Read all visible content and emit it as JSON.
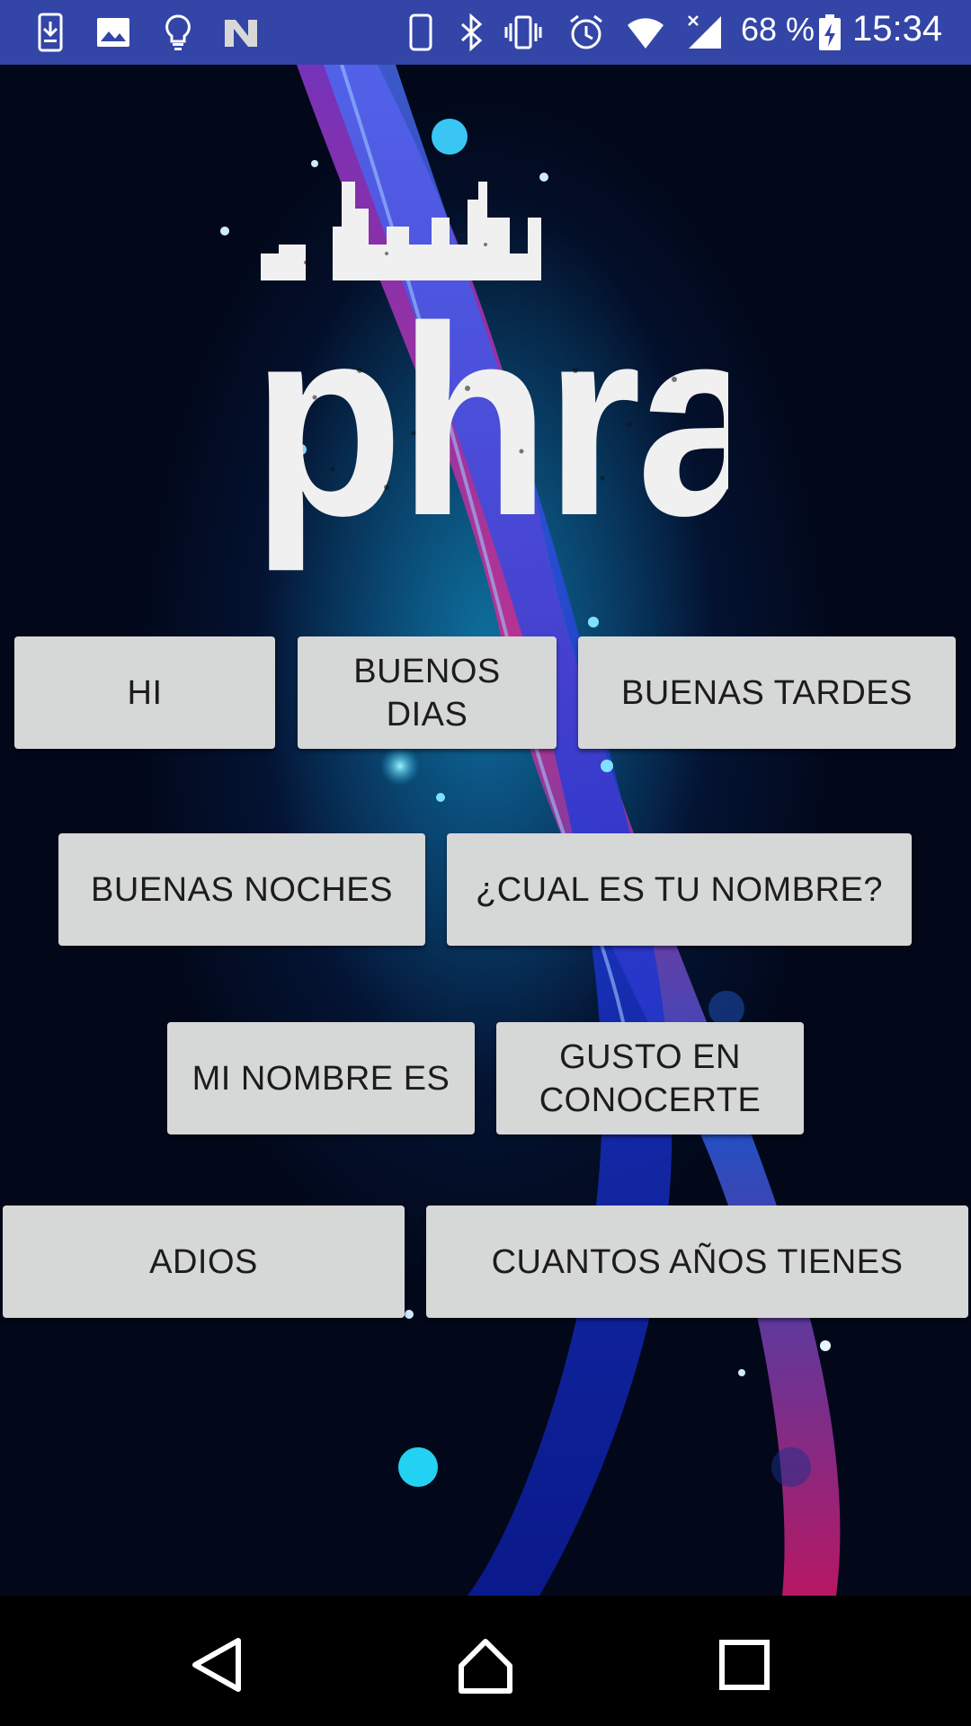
{
  "status_bar": {
    "left_icons": [
      "download-icon",
      "image-icon",
      "lightbulb-icon",
      "n-logo-icon"
    ],
    "right_icons": [
      "phone-icon",
      "bluetooth-icon",
      "vibrate-icon",
      "alarm-icon",
      "wifi-icon",
      "signal-icon"
    ],
    "battery_percent": "68 %",
    "time": "15:34"
  },
  "logo": {
    "text": "phrase"
  },
  "buttons": {
    "hi": "HI",
    "buenos_dias_line1": "BUENOS",
    "buenos_dias_line2": "DIAS",
    "buenas_tardes": "BUENAS TARDES",
    "buenas_noches": "BUENAS NOCHES",
    "cual_es_tu_nombre": "¿CUAL ES TU NOMBRE?",
    "mi_nombre_es": "MI NOMBRE ES",
    "gusto_line1": "GUSTO EN",
    "gusto_line2": "CONOCERTE",
    "adios": "ADIOS",
    "cuantos_anos": "CUANTOS AÑOS TIENES"
  },
  "nav_bar": {
    "icons": [
      "back-icon",
      "home-icon",
      "recents-icon"
    ]
  },
  "colors": {
    "status_bar": "#3345a6",
    "button_bg": "#d6d7d7",
    "button_text": "#1c1c1c"
  }
}
